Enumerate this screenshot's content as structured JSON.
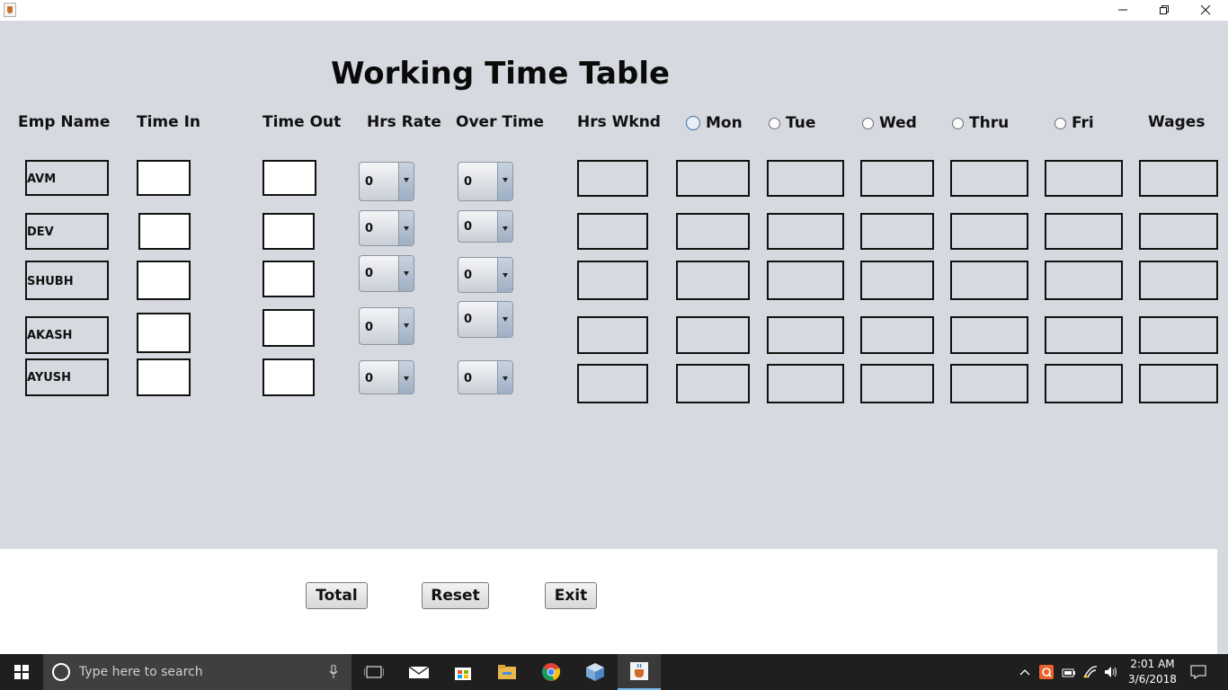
{
  "window": {
    "title": "",
    "minimize_icon": "minimize-icon",
    "restore_icon": "restore-icon",
    "close_icon": "close-icon"
  },
  "form": {
    "title": "Working Time Table",
    "headers": {
      "emp_name": "Emp Name",
      "time_in": "Time In",
      "time_out": "Time Out",
      "hrs_rate": "Hrs Rate",
      "over_time": "Over Time",
      "hrs_wknd": "Hrs Wknd",
      "wages": "Wages"
    },
    "days": [
      {
        "label": "Mon",
        "selected": false
      },
      {
        "label": "Tue",
        "selected": false
      },
      {
        "label": "Wed",
        "selected": false
      },
      {
        "label": "Thru",
        "selected": false
      },
      {
        "label": "Fri",
        "selected": false
      }
    ],
    "employees": [
      {
        "name": "AVM",
        "hrs_rate": "0",
        "over_time": "0"
      },
      {
        "name": "DEV",
        "hrs_rate": "0",
        "over_time": "0"
      },
      {
        "name": "SHUBH",
        "hrs_rate": "0",
        "over_time": "0"
      },
      {
        "name": "AKASH",
        "hrs_rate": "0",
        "over_time": "0"
      },
      {
        "name": "AYUSH",
        "hrs_rate": "0",
        "over_time": "0"
      }
    ],
    "buttons": {
      "total": "Total",
      "reset": "Reset",
      "exit": "Exit"
    }
  },
  "taskbar": {
    "search_placeholder": "Type here to search",
    "time": "2:01 AM",
    "date": "3/6/2018",
    "apps": [
      "task-view-icon",
      "mail-icon",
      "store-icon",
      "file-explorer-icon",
      "chrome-icon",
      "3d-box-icon",
      "java-icon"
    ],
    "tray": [
      "chevron-up-icon",
      "app-q-icon",
      "battery-icon",
      "wifi-icon",
      "volume-icon",
      "notification-icon"
    ]
  },
  "colors": {
    "panel": "#d6d9df",
    "taskbar": "#1f1f1f",
    "search": "#3f3f3f",
    "accent": "#76b9ed"
  }
}
